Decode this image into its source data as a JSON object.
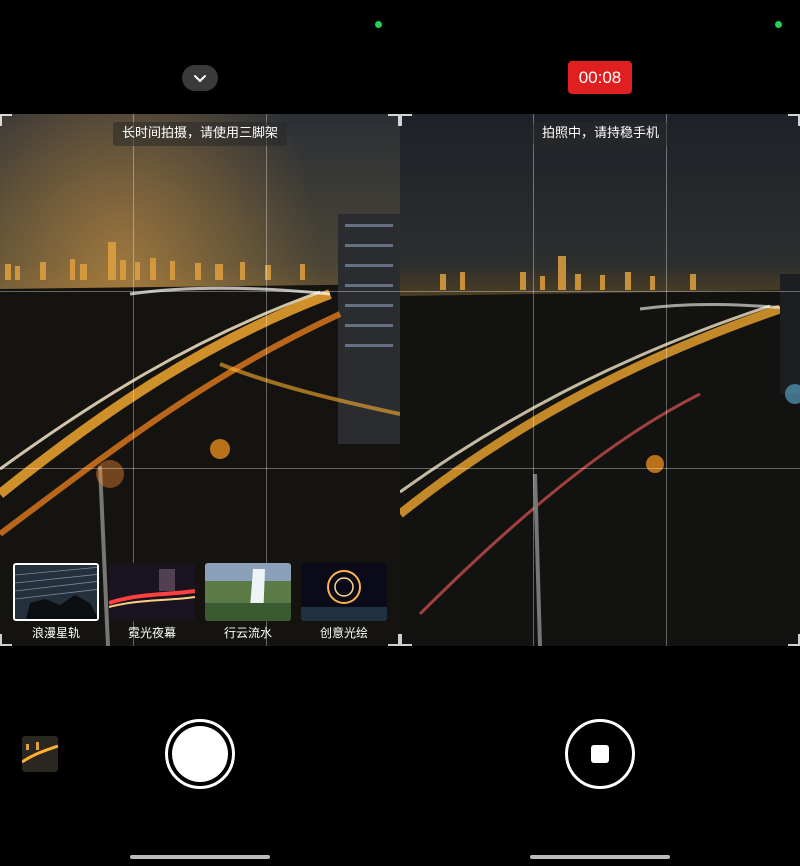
{
  "left_panel": {
    "hint": "长时间拍摄，请使用三脚架",
    "collapse_icon": "chevron-down-icon",
    "modes": [
      {
        "label": "浪漫星轨",
        "selected": true
      },
      {
        "label": "霓光夜幕",
        "selected": false
      },
      {
        "label": "行云流水",
        "selected": false
      },
      {
        "label": "创意光绘",
        "selected": false
      }
    ],
    "shutter_icon": "shutter-icon",
    "gallery_icon": "gallery-thumbnail"
  },
  "right_panel": {
    "timer": "00:08",
    "hint": "拍照中，请持稳手机",
    "stop_icon": "stop-icon"
  },
  "colors": {
    "status_dot": "#1fd15a",
    "timer_bg": "#e02020",
    "city_glow": "#f5a623"
  }
}
